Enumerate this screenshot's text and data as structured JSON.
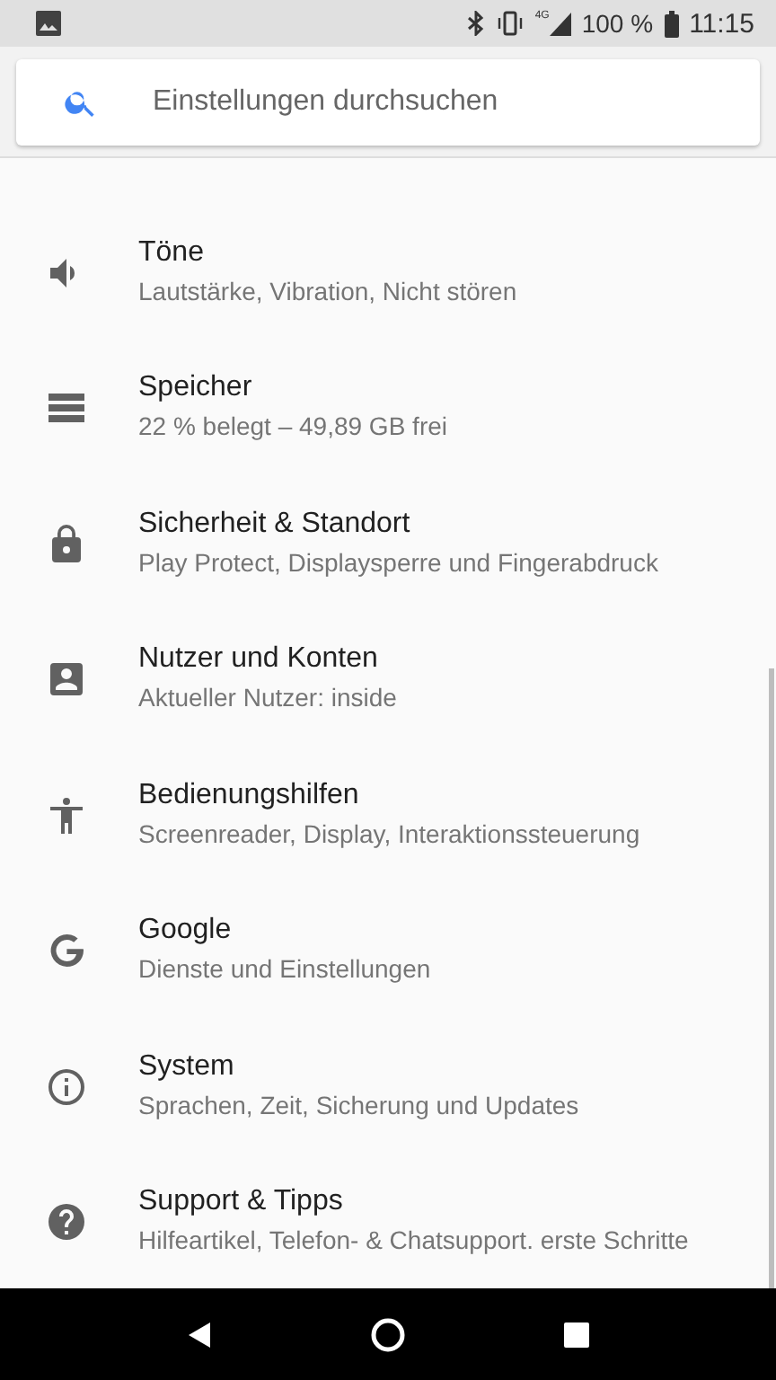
{
  "status_bar": {
    "network": "4G",
    "battery": "100 %",
    "time": "11:15"
  },
  "search": {
    "placeholder": "Einstellungen durchsuchen"
  },
  "items": [
    {
      "title": "Töne",
      "subtitle": "Lautstärke, Vibration, Nicht stören"
    },
    {
      "title": "Speicher",
      "subtitle": "22 % belegt – 49,89 GB frei"
    },
    {
      "title": "Sicherheit & Standort",
      "subtitle": "Play Protect, Displaysperre und Fingerabdruck"
    },
    {
      "title": "Nutzer und Konten",
      "subtitle": "Aktueller Nutzer: inside"
    },
    {
      "title": "Bedienungshilfen",
      "subtitle": "Screenreader, Display, Interaktionssteuerung"
    },
    {
      "title": "Google",
      "subtitle": "Dienste und Einstellungen"
    },
    {
      "title": "System",
      "subtitle": "Sprachen, Zeit, Sicherung und Updates"
    },
    {
      "title": "Support & Tipps",
      "subtitle": "Hilfeartikel, Telefon- & Chatsupport. erste Schritte"
    }
  ]
}
